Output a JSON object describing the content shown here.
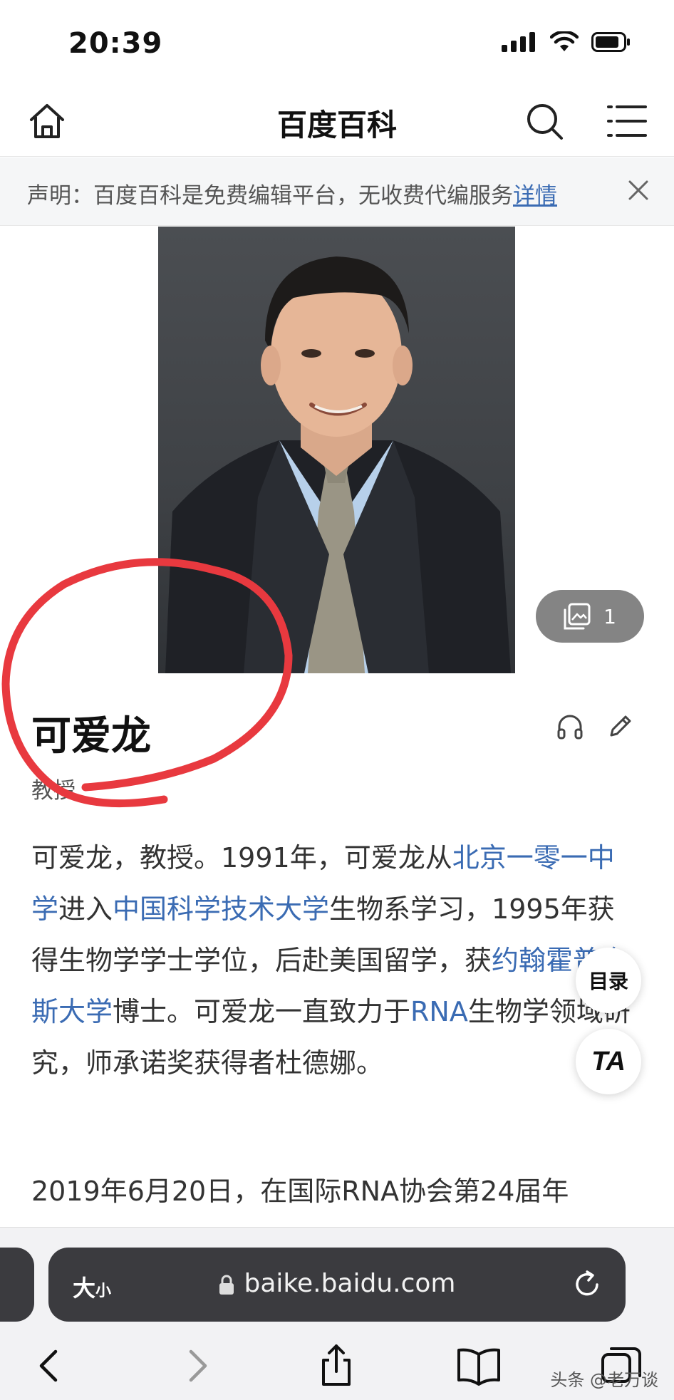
{
  "status_bar": {
    "time": "20:39"
  },
  "header": {
    "title": "百度百科"
  },
  "notice": {
    "text": "声明：百度百科是免费编辑平台，无收费代编服务",
    "link": "详情"
  },
  "album": {
    "count": "1"
  },
  "entry": {
    "title": "可爱龙",
    "subtitle": "教授",
    "paragraph1": [
      {
        "t": "可爱龙，教授。1991年，可爱龙从",
        "link": false
      },
      {
        "t": "北京一零一中学",
        "link": true
      },
      {
        "t": "进入",
        "link": false
      },
      {
        "t": "中国科学技术大学",
        "link": true
      },
      {
        "t": "生物系学习，1995年获得生物学学士学位，后赴美国留学，获",
        "link": false
      },
      {
        "t": "约翰霍普金斯大学",
        "link": true
      },
      {
        "t": "博士。可爱龙一直致力于",
        "link": false
      },
      {
        "t": "RNA",
        "link": true
      },
      {
        "t": "生物学领域研究，师承诺奖获得者杜德娜。",
        "link": false
      }
    ],
    "paragraph2": "2019年6月20日，在国际RNA协会第24届年"
  },
  "floating": {
    "toc_label": "目录",
    "text_size_label": "TA"
  },
  "browser": {
    "size_label": "大",
    "size_label_small": "小",
    "domain": "baike.baidu.com"
  },
  "watermark": "头条 @老万谈",
  "colors": {
    "link": "#3a6bb3",
    "annotation": "#e8393f",
    "url_bar": "#3b3b3f"
  }
}
